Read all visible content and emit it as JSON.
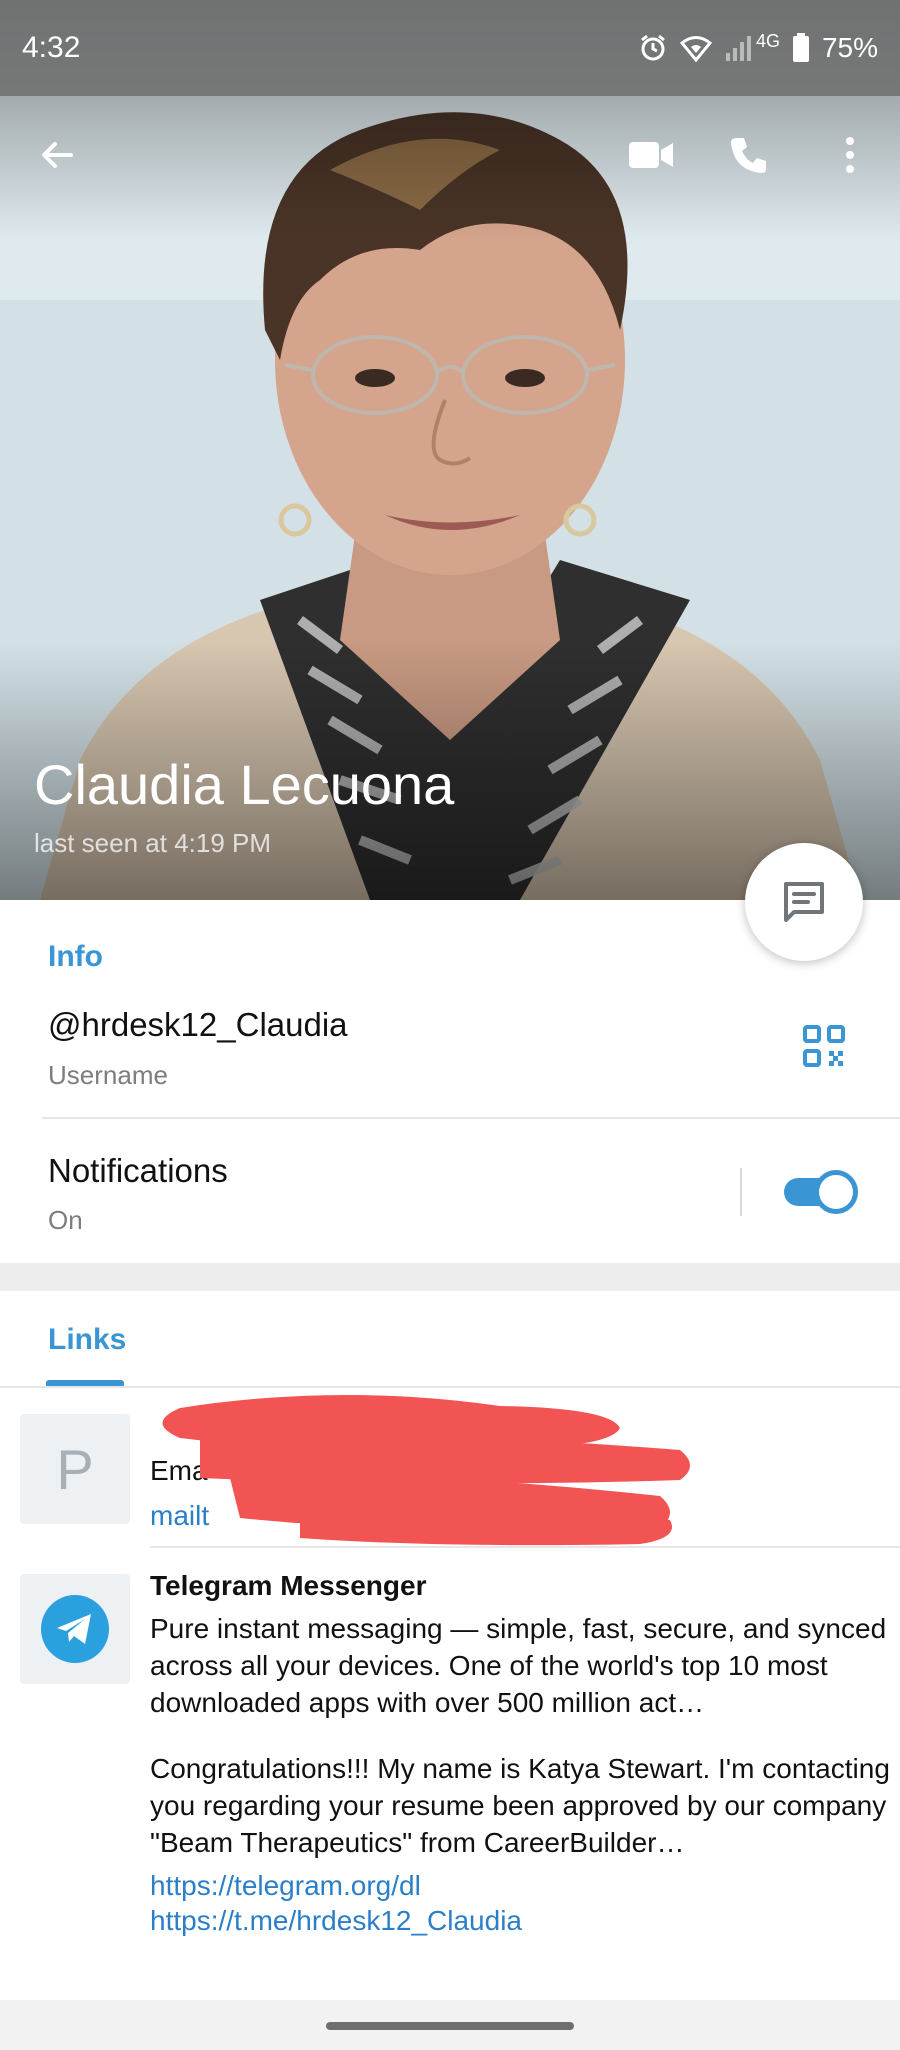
{
  "status_bar": {
    "time": "4:32",
    "network": "4G",
    "battery": "75%",
    "icons": [
      "alarm-icon",
      "wifi-icon",
      "signal-icon",
      "battery-icon"
    ]
  },
  "toolbar": {
    "icons": [
      "back-arrow-icon",
      "video-call-icon",
      "phone-icon",
      "more-vertical-icon"
    ]
  },
  "profile": {
    "name": "Claudia Lecuona",
    "last_seen": "last seen at 4:19 PM"
  },
  "info": {
    "section_title": "Info",
    "username": "@hrdesk12_Claudia",
    "username_label": "Username",
    "notifications_label": "Notifications",
    "notifications_state": "On",
    "notifications_enabled": true
  },
  "links": {
    "tab_label": "Links",
    "items": [
      {
        "thumb_letter": "P",
        "title_partial": "Ema",
        "url_partial": "mailt",
        "redacted": true
      },
      {
        "title": "Telegram Messenger",
        "description": "Pure instant messaging — simple, fast, secure, and synced across all your devices. One of the world's top 10 most downloaded apps with over 500 million act…",
        "message": "Congratulations!!! My name is Katya Stewart. I'm contacting you regarding your resume been approved by our company \"Beam Therapeutics\" from CareerBuilder…",
        "url_1": "https://telegram.org/dl",
        "url_2": "https://t.me/hrdesk12_Claudia"
      }
    ]
  },
  "colors": {
    "accent": "#3a95d5",
    "link": "#2a7fc8",
    "telegram": "#2aa0de",
    "redaction": "#f25454"
  }
}
